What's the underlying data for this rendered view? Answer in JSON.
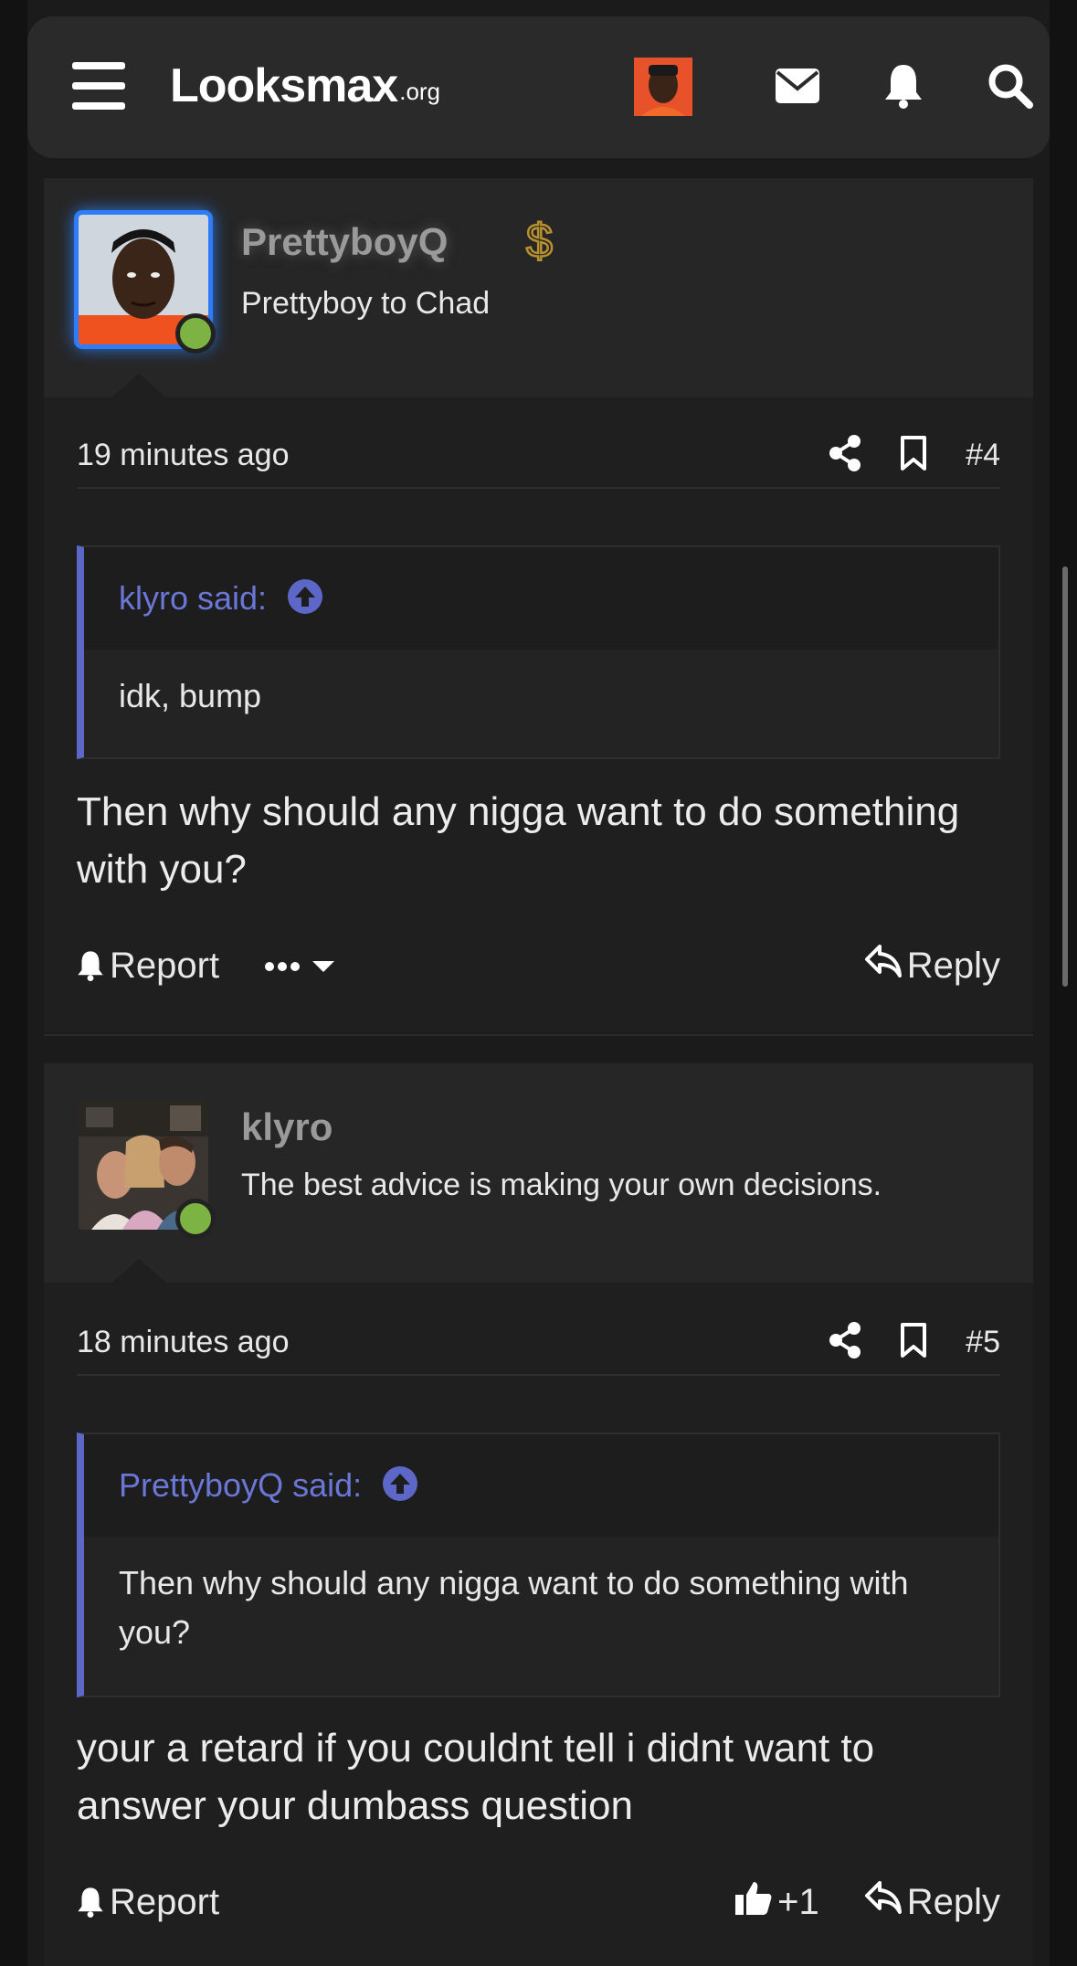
{
  "navbar": {
    "logo_main": "Looksmax",
    "logo_sub": ".org"
  },
  "posts": [
    {
      "username": "PrettyboyQ",
      "user_title": "Prettyboy to Chad",
      "time": "19 minutes ago",
      "post_number": "#4",
      "quote": {
        "author": "klyro said:",
        "body": "idk, bump"
      },
      "message": "Then why should any nigga want to do something with you?",
      "actions": {
        "report": "Report",
        "reply": "Reply"
      }
    },
    {
      "username": "klyro",
      "user_title": "The best advice is making your own decisions.",
      "time": "18 minutes ago",
      "post_number": "#5",
      "quote": {
        "author": "PrettyboyQ said:",
        "body": "Then why should any nigga want to do something with you?"
      },
      "message": "your a retard if you couldnt tell i didnt want to answer your dumbass question",
      "actions": {
        "report": "Report",
        "like_count": "+1",
        "reply": "Reply"
      }
    }
  ],
  "colors": {
    "accent": "#5c67c8",
    "online": "#7cb342",
    "supporter_badge": "#b8912e"
  },
  "icons": [
    "menu-icon",
    "envelope-icon",
    "bell-icon",
    "search-icon",
    "share-icon",
    "bookmark-icon",
    "arrow-up-circle-icon",
    "reply-icon",
    "thumbs-up-icon",
    "more-icon",
    "dollar-badge-icon"
  ]
}
